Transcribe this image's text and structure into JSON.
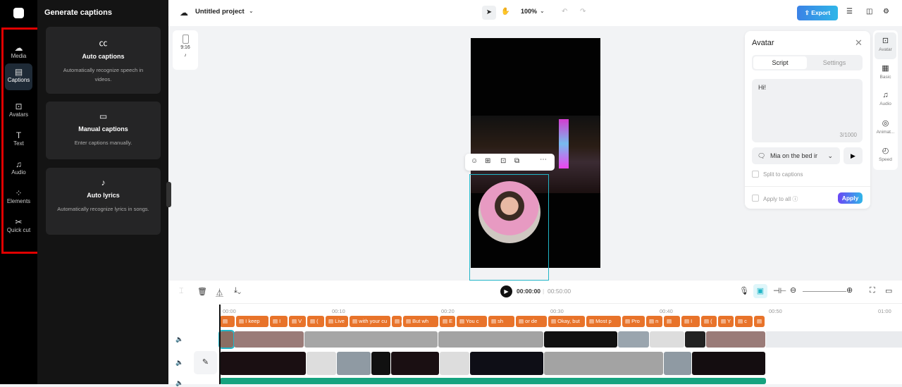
{
  "rail": {
    "items": [
      {
        "label": "Media",
        "icon": "cloud-upload-icon",
        "glyph": "☁"
      },
      {
        "label": "Captions",
        "icon": "captions-icon",
        "glyph": "▤"
      },
      {
        "label": "Avatars",
        "icon": "avatar-icon",
        "glyph": "⊡"
      },
      {
        "label": "Text",
        "icon": "text-icon",
        "glyph": "T"
      },
      {
        "label": "Audio",
        "icon": "music-icon",
        "glyph": "♫"
      },
      {
        "label": "Elements",
        "icon": "elements-icon",
        "glyph": "⁘"
      },
      {
        "label": "Quick cut",
        "icon": "quick-cut-icon",
        "glyph": "✂"
      }
    ]
  },
  "panel": {
    "title": "Generate captions",
    "cards": [
      {
        "title": "Auto captions",
        "desc": "Automatically recognize speech in videos.",
        "glyph": "㏄"
      },
      {
        "title": "Manual captions",
        "desc": "Enter captions manually.",
        "glyph": "▭"
      },
      {
        "title": "Auto lyrics",
        "desc": "Automatically recognize lyrics in songs.",
        "glyph": "♪"
      }
    ]
  },
  "topbar": {
    "project": "Untitled project",
    "zoom": "100%",
    "export": "Export"
  },
  "ratio": {
    "label": "9:16"
  },
  "avatar_panel": {
    "title": "Avatar",
    "tabs": [
      "Script",
      "Settings"
    ],
    "script": "Hi!",
    "count": "3/1000",
    "voice": "Mia on the bed ir",
    "split": "Split to captions",
    "apply_all": "Apply to all",
    "apply": "Apply"
  },
  "right_panel": [
    "Avatar",
    "Basic",
    "Audio",
    "Animat...",
    "Speed"
  ],
  "timeline": {
    "current": "00:00:00",
    "total": "00:50:00",
    "ticks": [
      "00:00",
      "00:10",
      "00:20",
      "00:30",
      "00:40",
      "00:50",
      "01:00"
    ],
    "captions": [
      "",
      "I keep",
      "I",
      "V",
      "(",
      "Live",
      "with your cu",
      "(",
      "But wh",
      "E",
      "You c",
      "sh",
      "or de",
      "Okay, but",
      "Most p",
      "Pro",
      "n",
      "",
      "I",
      "(",
      "Y",
      "c",
      ""
    ]
  },
  "colors": {
    "accent": "#e8732a",
    "selection": "#21b5c7",
    "audio": "#16a37f"
  }
}
